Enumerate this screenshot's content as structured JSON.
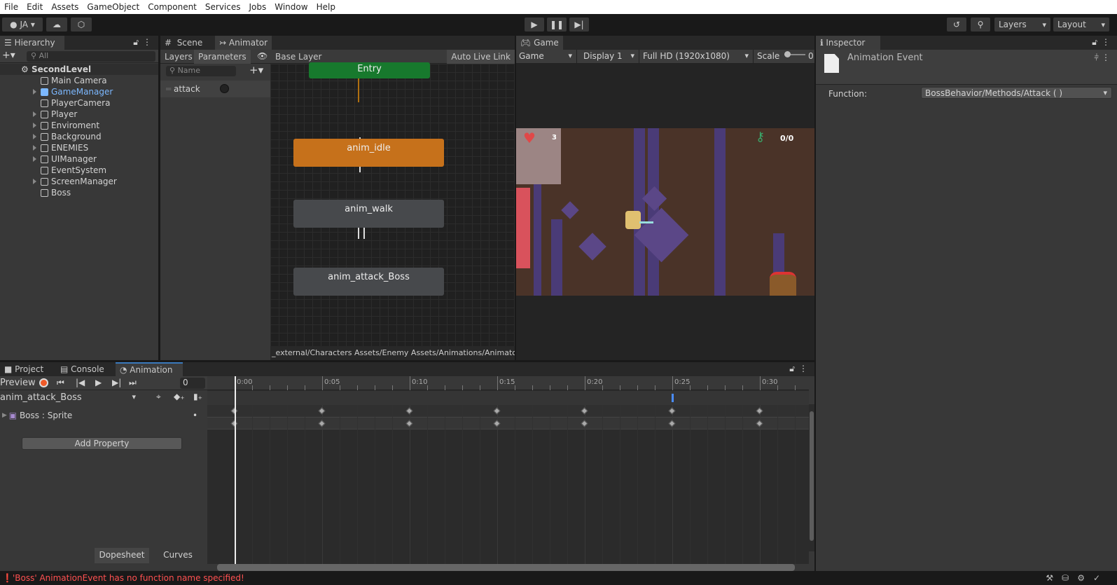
{
  "menu": [
    "File",
    "Edit",
    "Assets",
    "GameObject",
    "Component",
    "Services",
    "Jobs",
    "Window",
    "Help"
  ],
  "toolbar": {
    "account": "JA",
    "layers": "Layers",
    "layout": "Layout"
  },
  "hierarchy": {
    "tab": "Hierarchy",
    "search_placeholder": "All",
    "scene": "SecondLevel",
    "items": [
      {
        "label": "Main Camera",
        "expandable": false,
        "selected": false
      },
      {
        "label": "GameManager",
        "expandable": true,
        "selected": true
      },
      {
        "label": "PlayerCamera",
        "expandable": false,
        "selected": false
      },
      {
        "label": "Player",
        "expandable": true,
        "selected": false
      },
      {
        "label": "Enviroment",
        "expandable": true,
        "selected": false
      },
      {
        "label": "Background",
        "expandable": true,
        "selected": false
      },
      {
        "label": "ENEMIES",
        "expandable": true,
        "selected": false
      },
      {
        "label": "UIManager",
        "expandable": true,
        "selected": false
      },
      {
        "label": "EventSystem",
        "expandable": false,
        "selected": false
      },
      {
        "label": "ScreenManager",
        "expandable": true,
        "selected": false
      },
      {
        "label": "Boss",
        "expandable": false,
        "selected": false
      }
    ]
  },
  "animator": {
    "tabs": [
      "Scene",
      "Animator"
    ],
    "subtabs": [
      "Layers",
      "Parameters"
    ],
    "layer": "Base Layer",
    "auto_live_link": "Auto Live Link",
    "name_placeholder": "Name",
    "parameters": [
      {
        "name": "attack",
        "type": "trigger"
      }
    ],
    "states": {
      "entry": "Entry",
      "idle": "anim_idle",
      "walk": "anim_walk",
      "attack": "anim_attack_Boss"
    },
    "path": "_external/Characters Assets/Enemy Assets/Animations/Animator Contro"
  },
  "game": {
    "tab": "Game",
    "mode": "Game",
    "display": "Display 1",
    "resolution": "Full HD (1920x1080)",
    "scale_label": "Scale",
    "scale_value": "0",
    "hud_lives": "3",
    "hud_keys": "0/0"
  },
  "inspector": {
    "tab": "Inspector",
    "title": "Animation Event",
    "function_label": "Function:",
    "function_value": "BossBehavior/Methods/Attack ( )"
  },
  "bottom": {
    "tabs": [
      "Project",
      "Console",
      "Animation"
    ],
    "preview": "Preview",
    "frame": "0",
    "clip": "anim_attack_Boss",
    "property": "Boss : Sprite",
    "add_property": "Add Property",
    "dopesheet": "Dopesheet",
    "curves": "Curves",
    "time_labels": [
      "0:00",
      "0:05",
      "0:10",
      "0:15",
      "0:20",
      "0:25",
      "0:30"
    ],
    "keyframes": [
      0,
      5,
      10,
      15,
      20,
      25,
      30
    ],
    "event_marker": 25
  },
  "status": {
    "error": "'Boss' AnimationEvent has no function name specified!",
    "error_color": "#ff5050"
  }
}
